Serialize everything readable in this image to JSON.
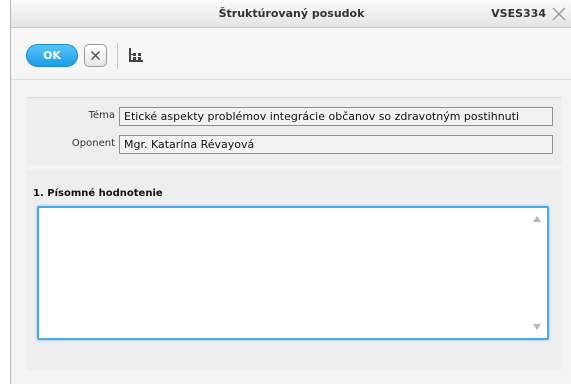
{
  "window": {
    "title": "Štruktúrovaný posudok",
    "id": "VSES334"
  },
  "toolbar": {
    "ok_label": "OK",
    "cancel_icon": "x-icon",
    "tree_icon": "tree-structure-icon"
  },
  "fields": {
    "tema_label": "Téma",
    "tema_value": "Etické aspekty problémov integrácie občanov so zdravotným postihnuti",
    "oponent_label": "Oponent",
    "oponent_value": "Mgr. Katarína Révayová"
  },
  "section": {
    "title": "1. Písomné hodnotenie",
    "text_value": ""
  },
  "colors": {
    "ok_button": "#1a9fe6",
    "focus_border": "#4aa8e8"
  }
}
